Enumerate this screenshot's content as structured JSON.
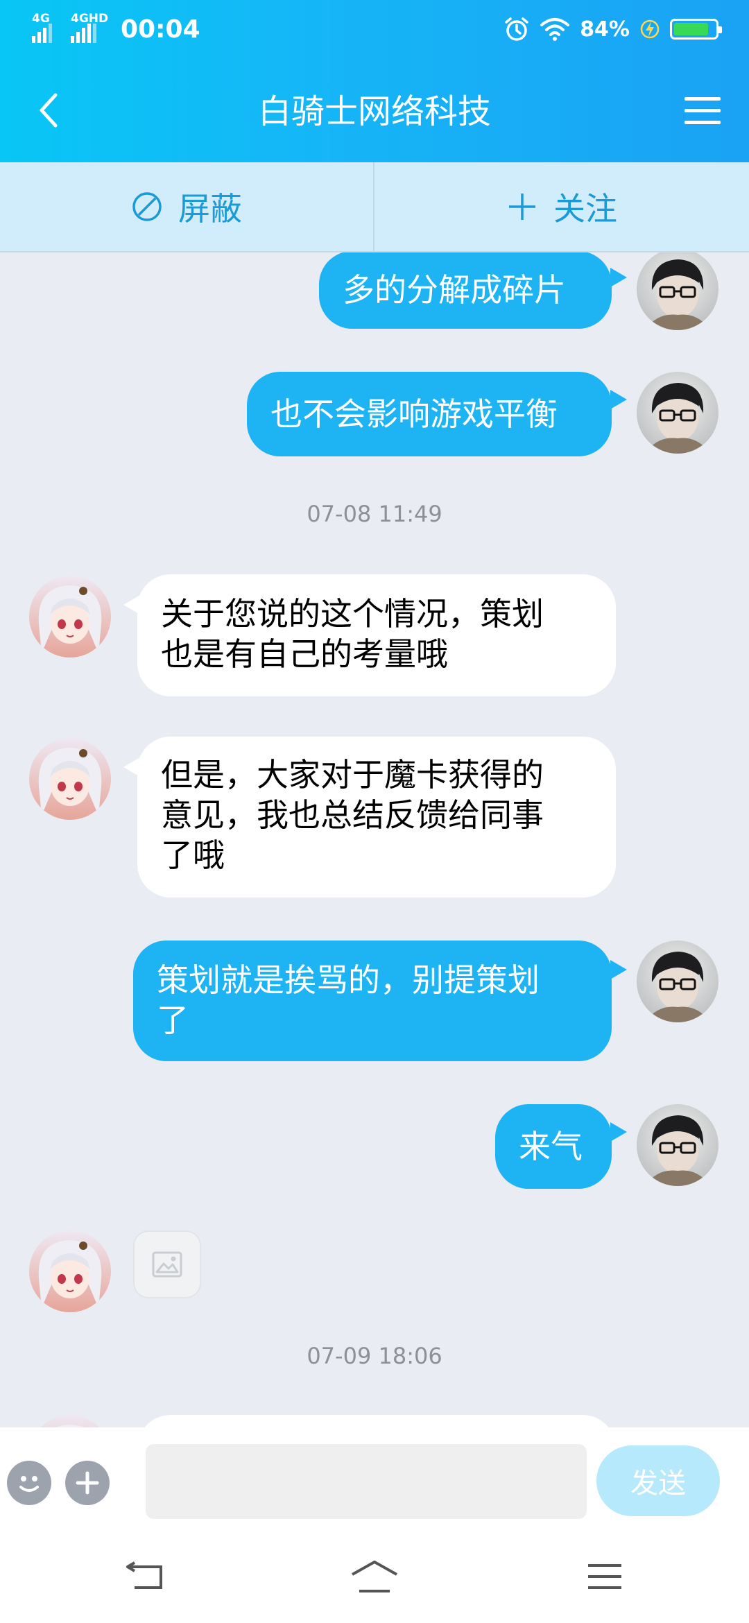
{
  "status_bar": {
    "network_1": "4G",
    "network_2": "4GHD",
    "time": "00:04",
    "battery_percent": "84%",
    "battery_level": 0.84,
    "icons": [
      "signal-icon",
      "alarm-icon",
      "wifi-icon",
      "charging-icon",
      "battery-icon"
    ]
  },
  "header": {
    "title": "白骑士网络科技",
    "back_icon": "chevron-left-icon",
    "menu_icon": "hamburger-menu-icon"
  },
  "actions": {
    "block_label": "屏蔽",
    "block_icon": "block-icon",
    "follow_label": "关注",
    "follow_icon": "plus-icon"
  },
  "messages": [
    {
      "side": "me",
      "text": "多的分解成碎片"
    },
    {
      "side": "me",
      "text": "也不会影响游戏平衡"
    },
    {
      "type": "timestamp",
      "text": "07-08 11:49"
    },
    {
      "side": "them",
      "line1": "关于您说的这个情况，策划",
      "line2": "也是有自己的考量哦"
    },
    {
      "side": "them",
      "line1": "但是，大家对于魔卡获得的",
      "line2": "意见，我也总结反馈给同事",
      "line3": "了哦"
    },
    {
      "side": "me",
      "line1": "策划就是挨骂的，别提策划",
      "line2": "了"
    },
    {
      "side": "me",
      "text": "来气"
    },
    {
      "side": "them",
      "type": "image",
      "icon": "image-placeholder-icon"
    },
    {
      "type": "timestamp",
      "text": "07-09 18:06"
    }
  ],
  "input": {
    "placeholder": "",
    "value": "",
    "emoji_icon": "emoji-icon",
    "add_icon": "plus-circle-icon",
    "send_label": "发送"
  },
  "system_nav": {
    "icons": [
      "back-nav-icon",
      "home-nav-icon",
      "recents-nav-icon"
    ]
  },
  "colors": {
    "header_gradient_start": "#08c6f5",
    "header_gradient_end": "#1aa2f4",
    "action_bar_bg": "#d1edfb",
    "action_text": "#1a9ad6",
    "my_bubble": "#1eb3f3",
    "their_bubble": "#ffffff",
    "chat_bg": "#e9ecf3",
    "send_button": "#b6e9fb"
  }
}
